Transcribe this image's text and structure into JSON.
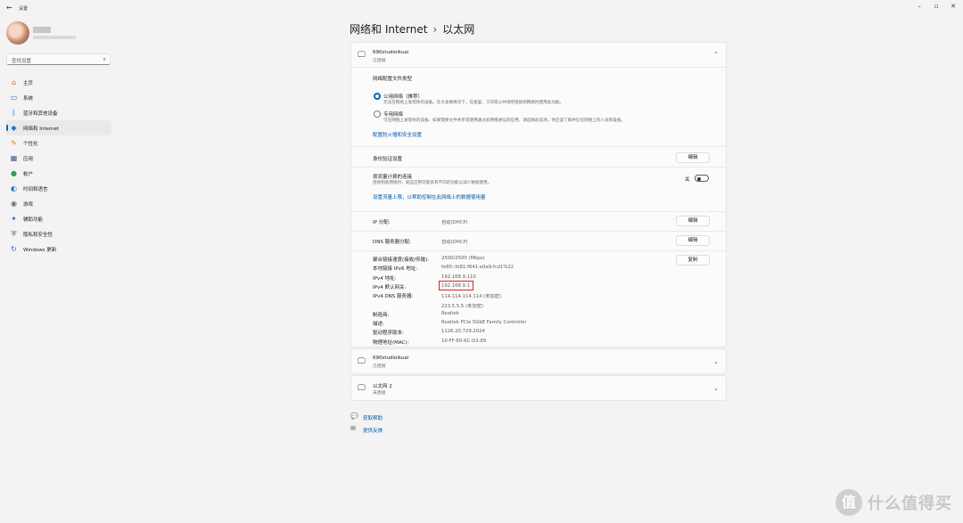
{
  "window": {
    "app_title": "设置"
  },
  "sidebar": {
    "search_placeholder": "查找设置",
    "items": [
      {
        "label": "主页",
        "icon": "home-icon",
        "glyph": "⌂",
        "color": "#c76a2c"
      },
      {
        "label": "系统",
        "icon": "system-icon",
        "glyph": "▭",
        "color": "#1e73c8"
      },
      {
        "label": "蓝牙和其他设备",
        "icon": "bluetooth-icon",
        "glyph": "ᛒ",
        "color": "#1e73c8"
      },
      {
        "label": "网络和 Internet",
        "icon": "network-icon",
        "glyph": "◆",
        "color": "#1e73c8",
        "active": true
      },
      {
        "label": "个性化",
        "icon": "personalization-icon",
        "glyph": "✎",
        "color": "#d08a1f"
      },
      {
        "label": "应用",
        "icon": "apps-icon",
        "glyph": "▦",
        "color": "#3b5b8a"
      },
      {
        "label": "帐户",
        "icon": "account-icon",
        "glyph": "●",
        "color": "#2e9e5b"
      },
      {
        "label": "时间和语言",
        "icon": "time-language-icon",
        "glyph": "◐",
        "color": "#1e73c8"
      },
      {
        "label": "游戏",
        "icon": "gaming-icon",
        "glyph": "◉",
        "color": "#5a6b7c"
      },
      {
        "label": "辅助功能",
        "icon": "accessibility-icon",
        "glyph": "✦",
        "color": "#1e73c8"
      },
      {
        "label": "隐私和安全性",
        "icon": "privacy-shield-icon",
        "glyph": "⛨",
        "color": "#5a6b7c"
      },
      {
        "label": "Windows 更新",
        "icon": "windows-update-icon",
        "glyph": "↻",
        "color": "#1e73c8"
      }
    ]
  },
  "header": {
    "breadcrumb_parent": "网络和 Internet",
    "breadcrumb_sep": "›",
    "breadcrumb_current": "以太网"
  },
  "main_card": {
    "name": "690studioikuai",
    "status": "已连接",
    "profile_type_label": "网络配置文件类型",
    "public": {
      "label": "公用网络（推荐）",
      "desc": "无法在网络上发现你的设备。在大多数情况下，在家里、工作或公共场所连接到网络时使用此功能。"
    },
    "private": {
      "label": "专用网络",
      "desc": "可在网络上发现你的设备。如果需要文件共享或使用通过此网络通信的应用，请选择此选项。你应该了解并信任网络上的人员和设备。"
    },
    "firewall_link": "配置防火墙和安全设置",
    "auth_label": "身份验证设置",
    "edit": "编辑",
    "metered_label": "按流量计费的连接",
    "metered_desc": "连接到此网络时，某些应用可能具有不同的功能以减少数据使用。",
    "metered_state": "关",
    "data_limit_link": "设置流量上限，以帮助控制在此网络上的数据使用量",
    "ip_assign_label": "IP 分配:",
    "ip_assign_value": "自动(DHCP)",
    "dns_assign_label": "DNS 服务器分配:",
    "dns_assign_value": "自动(DHCP)",
    "copy": "复制",
    "properties": [
      {
        "label": "聚合链接速度(接收/传输):",
        "value": "2500/2500 (Mbps)"
      },
      {
        "label": "本地链接 IPv6 地址:",
        "value": "fe80::fe81:f641:e0a9:fcd1%22"
      },
      {
        "label": "IPv4 地址:",
        "value": "192.168.9.110"
      },
      {
        "label": "IPv4 默认网关:",
        "value": "192.168.9.1"
      },
      {
        "label": "IPv4 DNS 服务器:",
        "value": "114.114.114.114 (未加密)"
      },
      {
        "label": "",
        "value": "223.5.5.5 (未加密)"
      },
      {
        "label": "制造商:",
        "value": "Realtek"
      },
      {
        "label": "描述:",
        "value": "Realtek PCIe 5GbE Family Controller"
      },
      {
        "label": "驱动程序版本:",
        "value": "1126.20.729.2024"
      },
      {
        "label": "物理地址(MAC):",
        "value": "10-FF-E0-6C-D2-E6"
      }
    ]
  },
  "other_cards": [
    {
      "name": "690studioikuai",
      "status": "已连接"
    },
    {
      "name": "以太网 2",
      "status": "未连接"
    }
  ],
  "footer": {
    "help": "获取帮助",
    "feedback": "提供反馈"
  },
  "watermark": {
    "glyph": "值",
    "text": "什么值得买"
  }
}
